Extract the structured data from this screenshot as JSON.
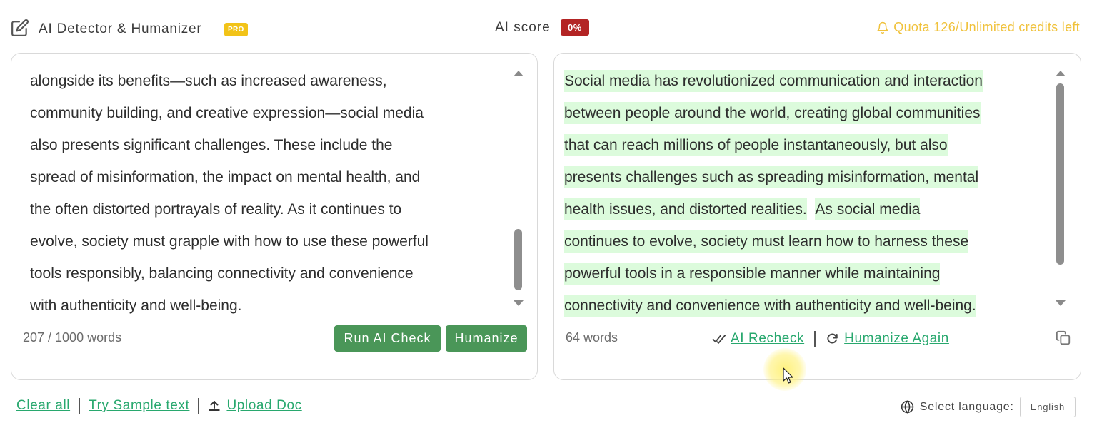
{
  "header": {
    "app_title": "AI Detector & Humanizer",
    "pro_badge": "PRO",
    "ai_score_label": "AI score",
    "ai_score_value": "0%",
    "quota_text": "Quota 126/Unlimited credits left",
    "icons": {
      "edit": "edit-icon",
      "bell": "bell-icon"
    },
    "colors": {
      "pro": "#f2c318",
      "score": "#b32424",
      "quota": "#f0c23c"
    }
  },
  "input_panel": {
    "lines": [
      "alongside its benefits—such as increased awareness,",
      "community building, and creative expression—social media",
      "also presents significant challenges. These include the",
      "spread of misinformation, the impact on mental health, and",
      "the often distorted portrayals of reality. As it continues to",
      "evolve, society must grapple with how to use these powerful",
      "tools responsibly, balancing connectivity and convenience",
      "with authenticity and well-being."
    ],
    "word_count": "207 / 1000 words",
    "run_ai_check_label": "Run AI Check",
    "humanize_label": "Humanize"
  },
  "output_panel": {
    "lines": [
      "Social media has revolutionized communication and interaction",
      "between people around the world, creating global communities",
      "that can reach millions of people instantaneously, but also",
      "presents challenges such as spreading misinformation, mental",
      "health issues, and distorted realities.",
      "As social media",
      "continues to evolve, society must learn how to harness these",
      "powerful tools in a responsible manner while maintaining",
      "connectivity and convenience with authenticity and well-being."
    ],
    "word_count": "64 words",
    "ai_recheck_label": "AI Recheck",
    "humanize_again_label": "Humanize Again",
    "icons": {
      "recheck": "double-check-icon",
      "redo": "redo-icon",
      "copy": "copy-icon"
    },
    "highlight_color": "#dcfbdc"
  },
  "footer": {
    "clear_all": "Clear all",
    "try_sample": "Try Sample text",
    "upload_doc": "Upload Doc",
    "select_language_label": "Select language:",
    "language": "English",
    "link_color": "#28a86e"
  }
}
